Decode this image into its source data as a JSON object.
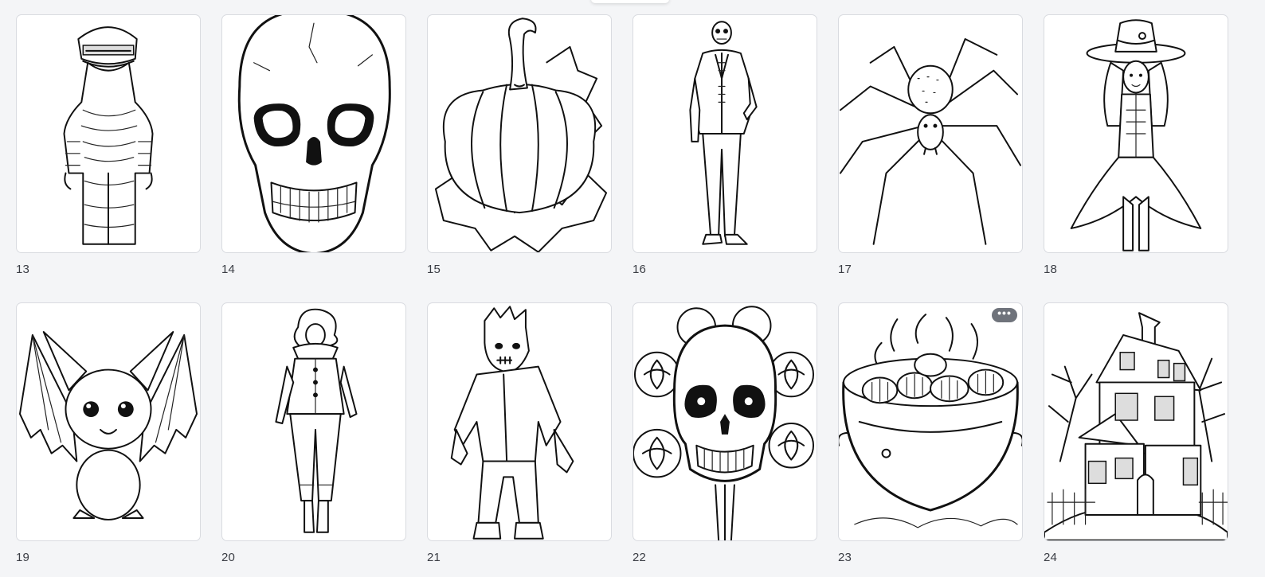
{
  "cards": [
    {
      "number": "13",
      "subject": "mummy"
    },
    {
      "number": "14",
      "subject": "skull"
    },
    {
      "number": "15",
      "subject": "pumpkin"
    },
    {
      "number": "16",
      "subject": "skeleton-in-suit"
    },
    {
      "number": "17",
      "subject": "spider"
    },
    {
      "number": "18",
      "subject": "witch"
    },
    {
      "number": "19",
      "subject": "bat"
    },
    {
      "number": "20",
      "subject": "clown"
    },
    {
      "number": "21",
      "subject": "zombie"
    },
    {
      "number": "22",
      "subject": "skull-with-roses"
    },
    {
      "number": "23",
      "subject": "cauldron"
    },
    {
      "number": "24",
      "subject": "haunted-house"
    }
  ],
  "more_button": {
    "icon": "ellipsis-icon",
    "glyph": "•••"
  }
}
